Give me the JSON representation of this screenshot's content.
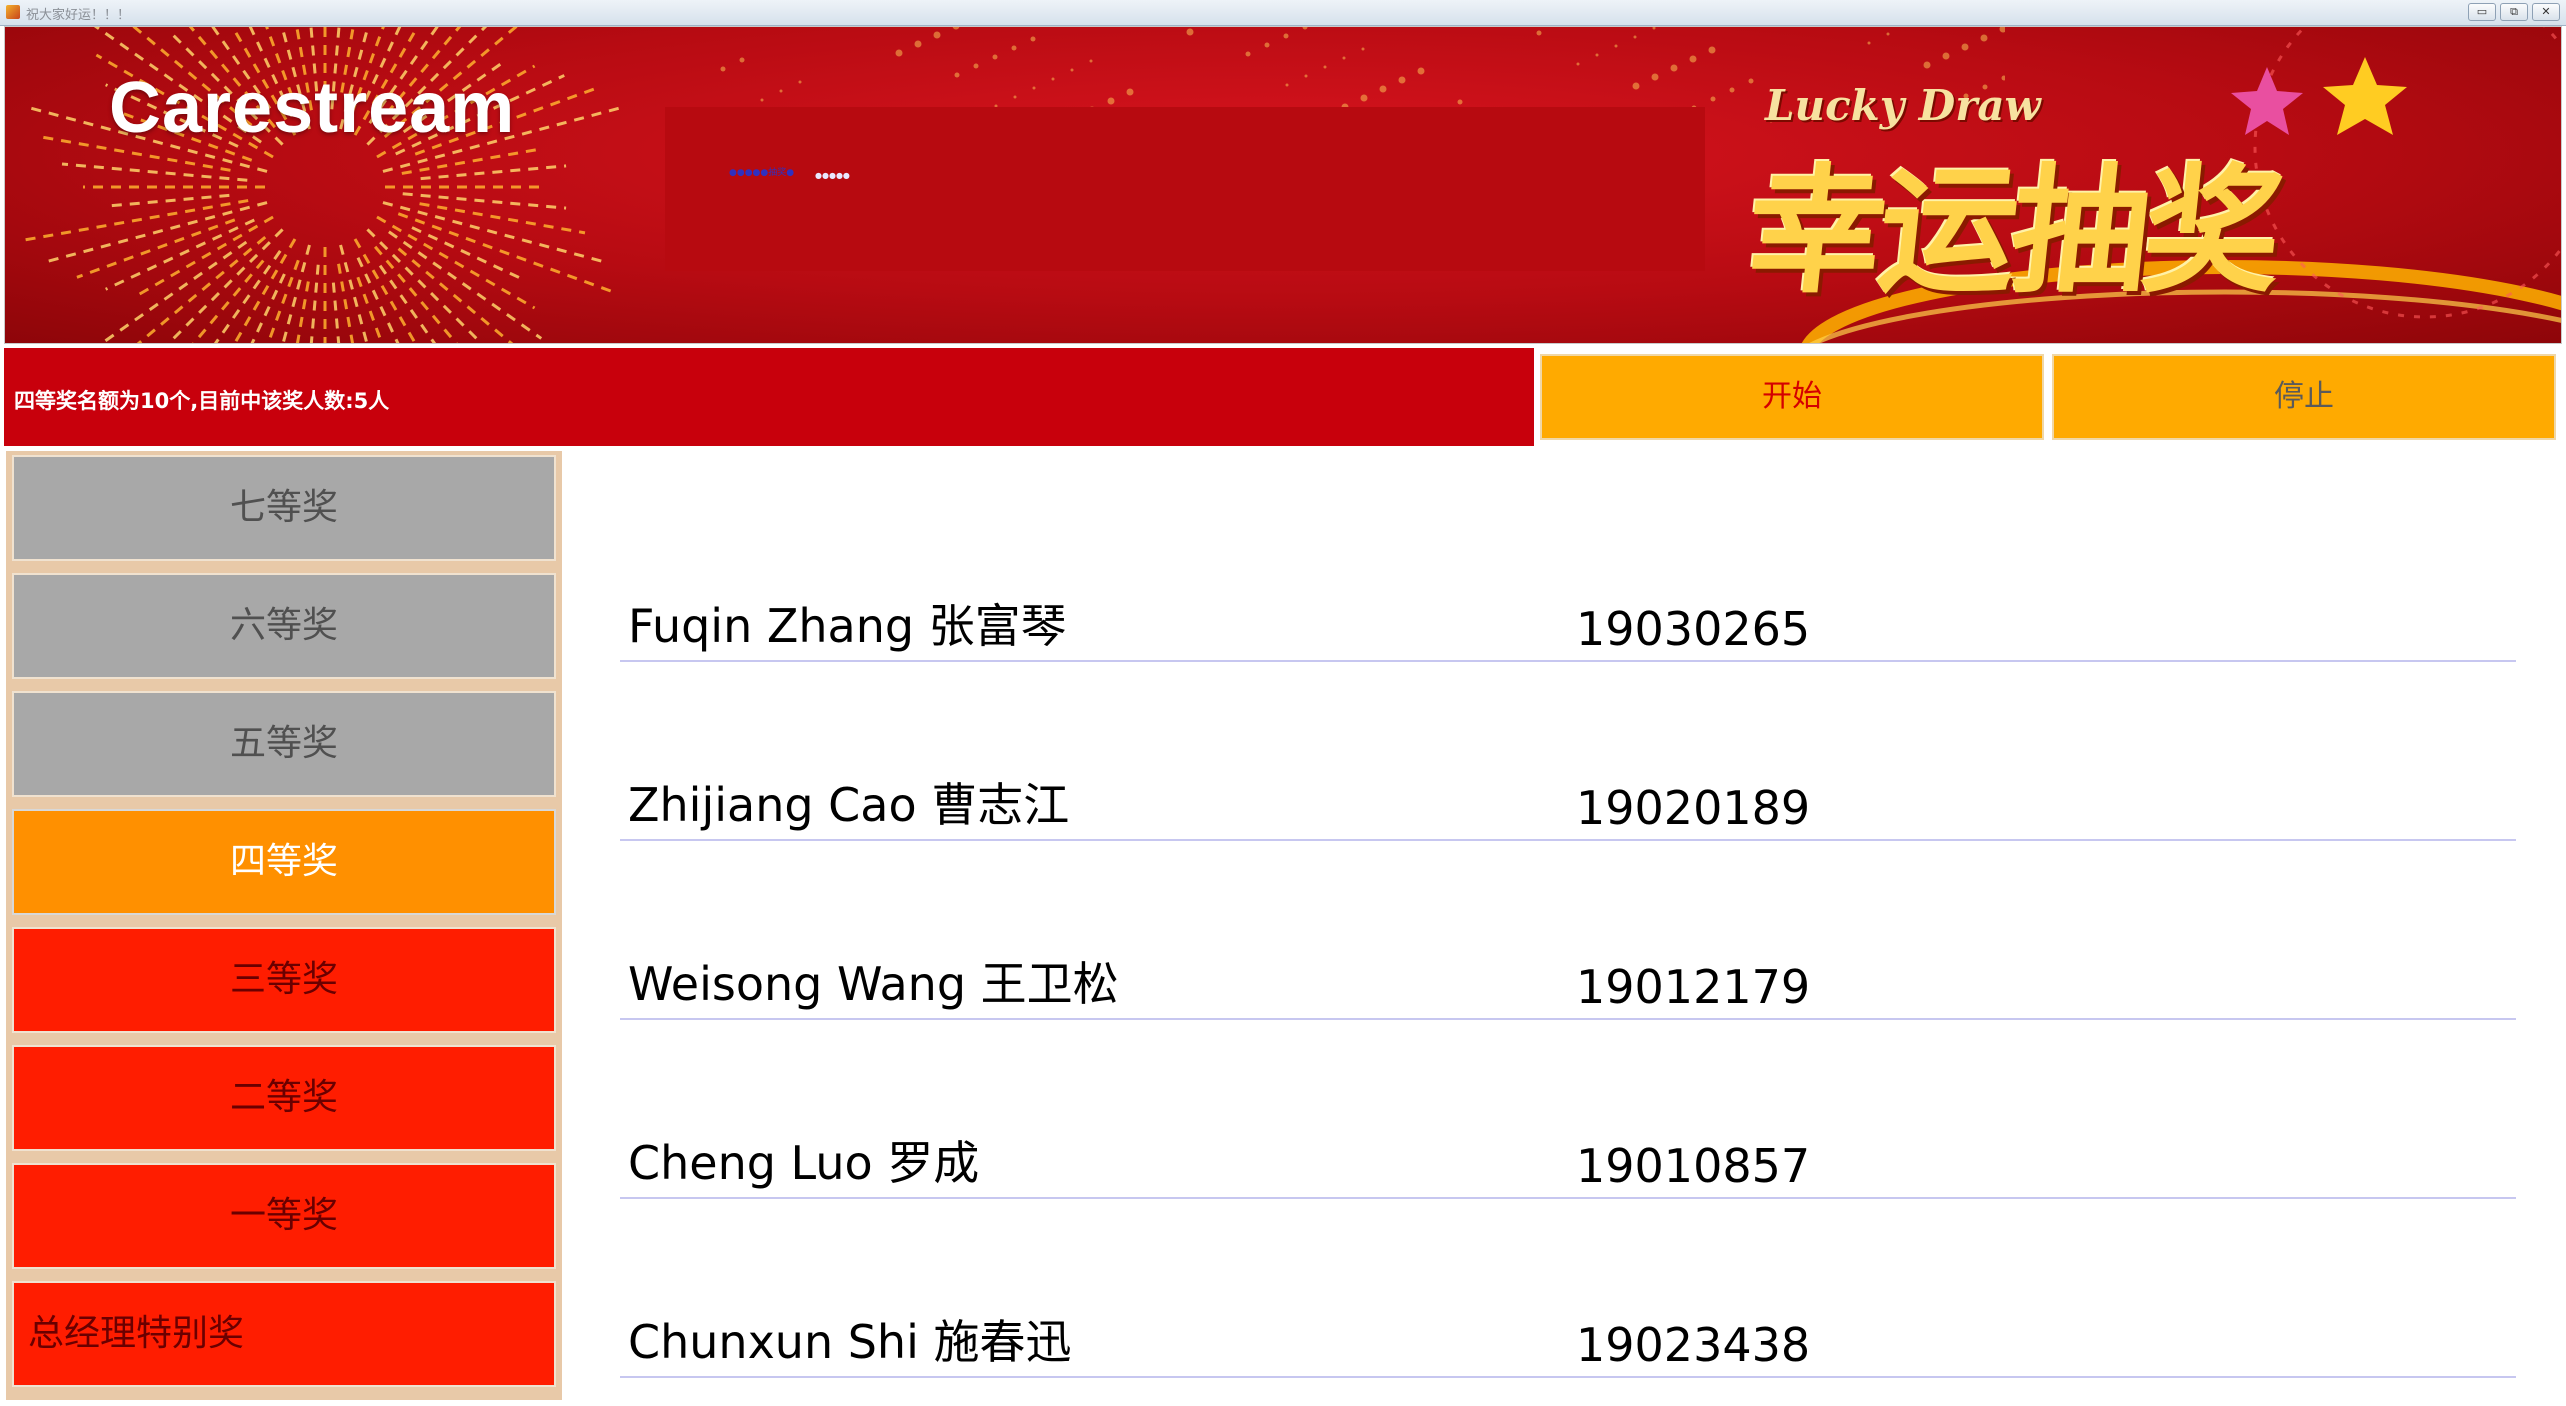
{
  "window": {
    "title": "祝大家好运！！！",
    "buttons": [
      "▭",
      "⧉",
      "✕"
    ]
  },
  "banner": {
    "logo": "Carestream",
    "tiny_text": "●●●●●抽奖●",
    "tiny_text2": "●●●●●",
    "lucky_en": "Lucky Draw",
    "lucky_cn": "幸运抽奖"
  },
  "status": {
    "text": "四等奖名额为10个,目前中该奖人数:5人"
  },
  "controls": {
    "start_label": "开始",
    "stop_label": "停止"
  },
  "prizes": [
    {
      "label": "七等奖",
      "state": "gray"
    },
    {
      "label": "六等奖",
      "state": "gray"
    },
    {
      "label": "五等奖",
      "state": "gray"
    },
    {
      "label": "四等奖",
      "state": "active"
    },
    {
      "label": "三等奖",
      "state": "red"
    },
    {
      "label": "二等奖",
      "state": "red"
    },
    {
      "label": "一等奖",
      "state": "red"
    },
    {
      "label": "总经理特别奖",
      "state": "red"
    }
  ],
  "winners": [
    {
      "name": "Fuqin Zhang 张富琴",
      "id": "19030265"
    },
    {
      "name": "Zhijiang Cao 曹志江",
      "id": "19020189"
    },
    {
      "name": "Weisong Wang 王卫松",
      "id": "19012179"
    },
    {
      "name": "Cheng Luo 罗成",
      "id": "19010857"
    },
    {
      "name": "Chunxun Shi 施春迅",
      "id": "19023438"
    }
  ],
  "colors": {
    "banner_red": "#b70b12",
    "status_red": "#c8000c",
    "button_orange": "#ffaa00",
    "active_prize": "#ff9000",
    "inactive_prize": "#a8a8a8",
    "remaining_prize": "#ff1d00"
  }
}
